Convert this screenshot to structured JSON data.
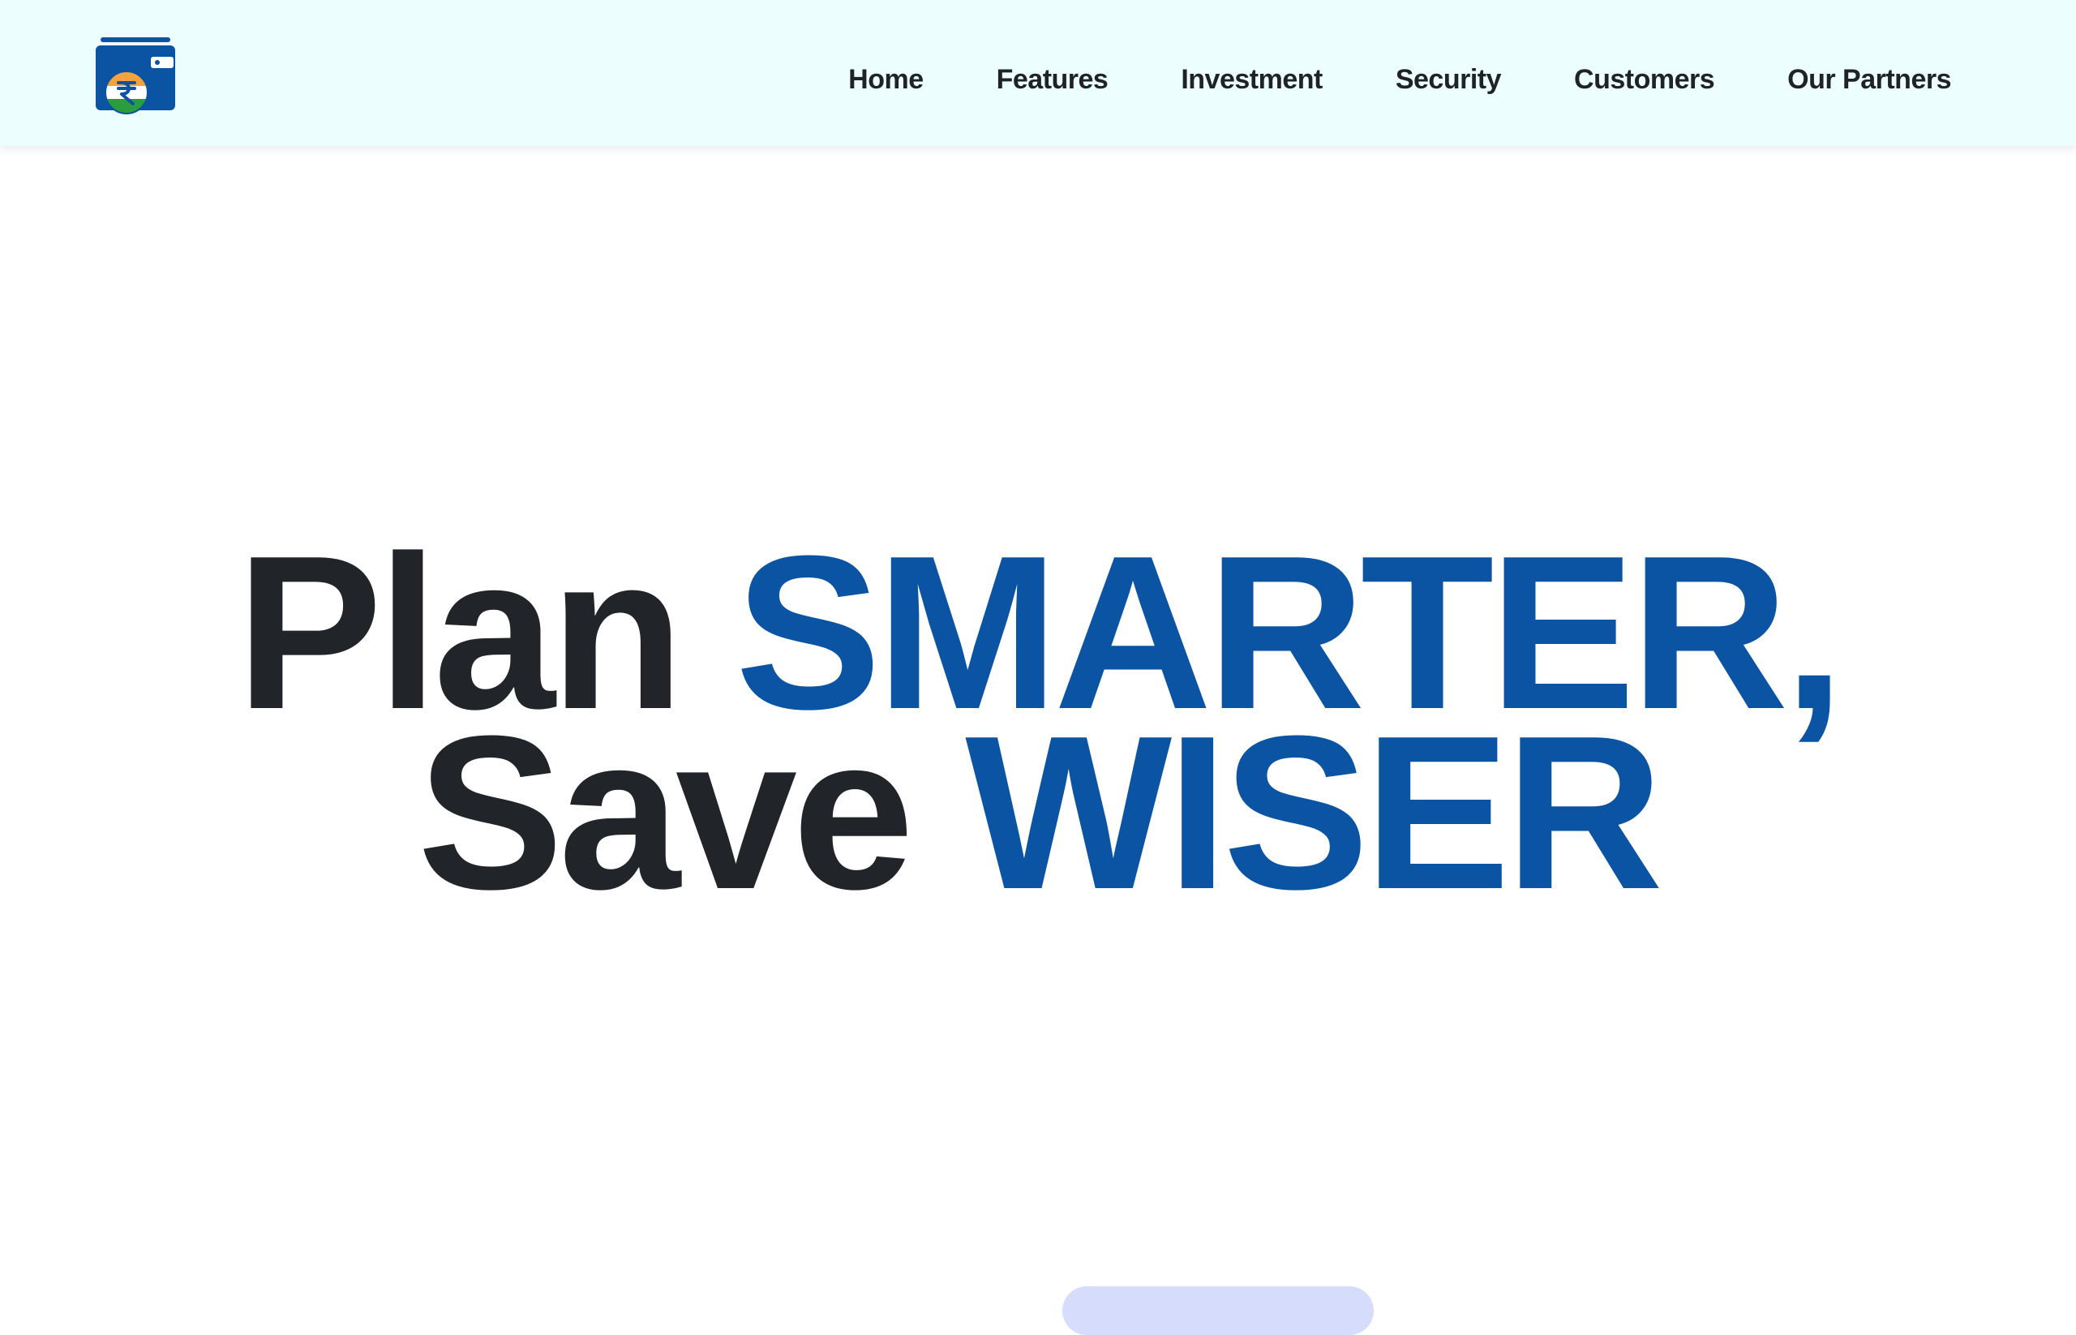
{
  "nav": {
    "logo_icon": "wallet-rupee-icon",
    "links": [
      "Home",
      "Features",
      "Investment",
      "Security",
      "Customers",
      "Our Partners"
    ]
  },
  "hero": {
    "line1_dark": "Plan ",
    "line1_blue": "SMARTER,",
    "line2_dark": "Save ",
    "line2_blue": "WISER"
  },
  "colors": {
    "nav_bg": "#ecfefe",
    "heading_dark": "#212428",
    "accent_blue": "#0b53a3",
    "cta_bg": "#d6dcfb"
  }
}
